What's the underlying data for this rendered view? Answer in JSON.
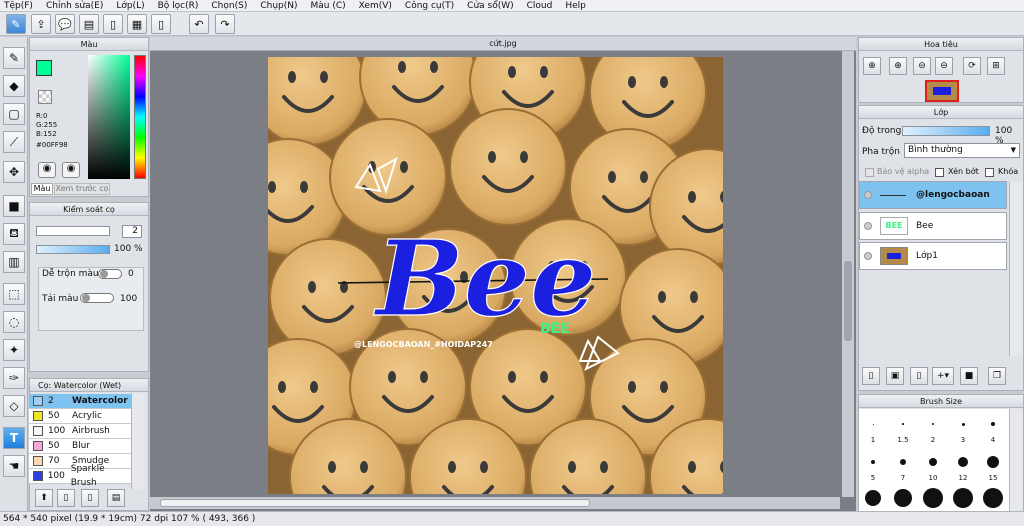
{
  "menu": [
    "Tệp(F)",
    "Chỉnh sửa(E)",
    "Lớp(L)",
    "Bộ lọc(R)",
    "Chọn(S)",
    "Chụp(N)",
    "Màu (C)",
    "Xem(V)",
    "Công cụ(T)",
    "Cửa sổ(W)",
    "Cloud",
    "Help"
  ],
  "color_panel": {
    "title": "Màu",
    "r": "R:0",
    "g": "G:255",
    "b": "B:152",
    "hex": "#00FF98",
    "current_color": "#00ff98",
    "tab_color": "Màu",
    "tab_preview": "Xem trước cọ"
  },
  "brush_control": {
    "title": "Kiểm soát cọ",
    "size_value": "2",
    "opacity_value": "100 %",
    "blend_label": "Dễ trộn màu",
    "blend_value": "0",
    "reload_label": "Tải màu",
    "reload_value": "100"
  },
  "brush_list": {
    "title": "Cọ: Watercolor (Wet)",
    "items": [
      {
        "size": "2",
        "name": "Watercolor",
        "color": "#9ad1f5"
      },
      {
        "size": "50",
        "name": "Acrylic",
        "color": "#f2e61a"
      },
      {
        "size": "100",
        "name": "Airbrush",
        "color": "#f5f5f5"
      },
      {
        "size": "50",
        "name": "Blur",
        "color": "#f3a8d8"
      },
      {
        "size": "70",
        "name": "Smudge",
        "color": "#f8dcb0"
      },
      {
        "size": "100",
        "name": "Sparkle Brush",
        "color": "#2e3fe0"
      }
    ]
  },
  "document": {
    "tab": "cứt.jpg",
    "watermark": "@LENGOCBAOAN_#HOIDAP247",
    "title_text": "Bee",
    "sub_text": "BEE"
  },
  "navigator": {
    "title": "Hoa tiêu"
  },
  "layer_panel": {
    "title": "Lớp",
    "opacity_label": "Độ trong",
    "opacity_value": "100 %",
    "blend_label": "Pha trộn",
    "blend_value": "Bình thường",
    "protect_alpha": "Bảo vệ alpha",
    "clipping": "Xén bớt",
    "lock": "Khóa",
    "layers": [
      {
        "name": "@lengocbaoan"
      },
      {
        "name": "Bee"
      },
      {
        "name": "Lớp1"
      }
    ]
  },
  "brush_size": {
    "title": "Brush Size",
    "labels_row1": [
      "1",
      "1.5",
      "2",
      "3",
      "4"
    ],
    "labels_row2": [
      "5",
      "7",
      "10",
      "12",
      "15"
    ]
  },
  "status": {
    "text": "564 * 540 pixel   (19.9 * 19cm)   72 dpi   107 %   ( 493, 366 )"
  },
  "colors": {
    "accent": "#3d86d4",
    "selection": "#7ec3f0",
    "text_blue": "#1a1fe0",
    "neon_green": "#3df08a"
  }
}
